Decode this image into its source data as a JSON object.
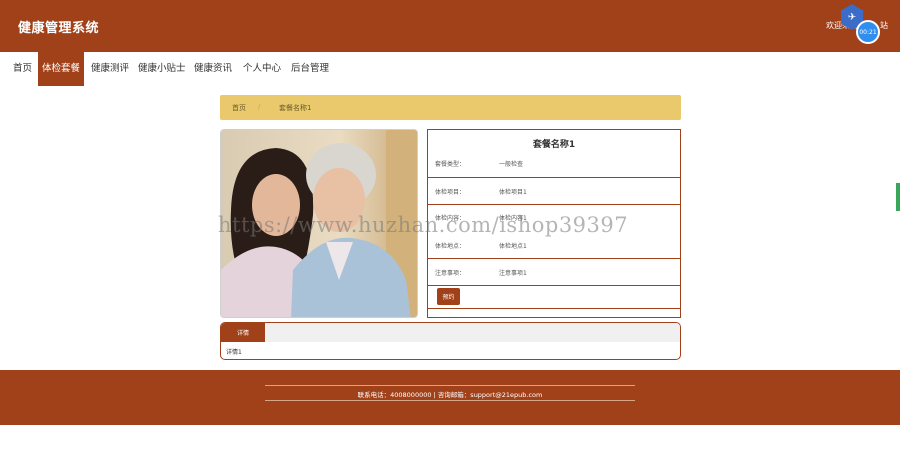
{
  "header": {
    "brand": "健康管理系统",
    "welcome": "欢迎来到",
    "welcome_suffix": "站",
    "timer": "00:21"
  },
  "nav": {
    "items": [
      {
        "label": "首页"
      },
      {
        "label": "体检套餐",
        "active": true
      },
      {
        "label": "健康测评"
      },
      {
        "label": "健康小贴士"
      },
      {
        "label": "健康资讯"
      },
      {
        "label": "个人中心"
      },
      {
        "label": "后台管理"
      }
    ]
  },
  "breadcrumb": {
    "home": "首页",
    "separator": "/",
    "current": "套餐名称1"
  },
  "detail": {
    "title": "套餐名称1",
    "fields": [
      {
        "label": "套餐类型：",
        "value": "一般检查"
      },
      {
        "label": "体检项目：",
        "value": "体检项目1"
      },
      {
        "label": "体检内容：",
        "value": "体检内容1"
      },
      {
        "label": "体检地点：",
        "value": "体检地点1"
      },
      {
        "label": "注意事项：",
        "value": "注意事项1"
      }
    ],
    "book_button": "预约"
  },
  "tabs": {
    "tab_label": "详情",
    "content": "详情1"
  },
  "footer": {
    "contact": "联系电话：4008000000 | 咨询邮箱：support@21epub.com"
  },
  "watermark": "https://www.huzhan.com/ishop39397",
  "colors": {
    "primary": "#a0411a",
    "breadcrumb": "#e9c96b"
  }
}
